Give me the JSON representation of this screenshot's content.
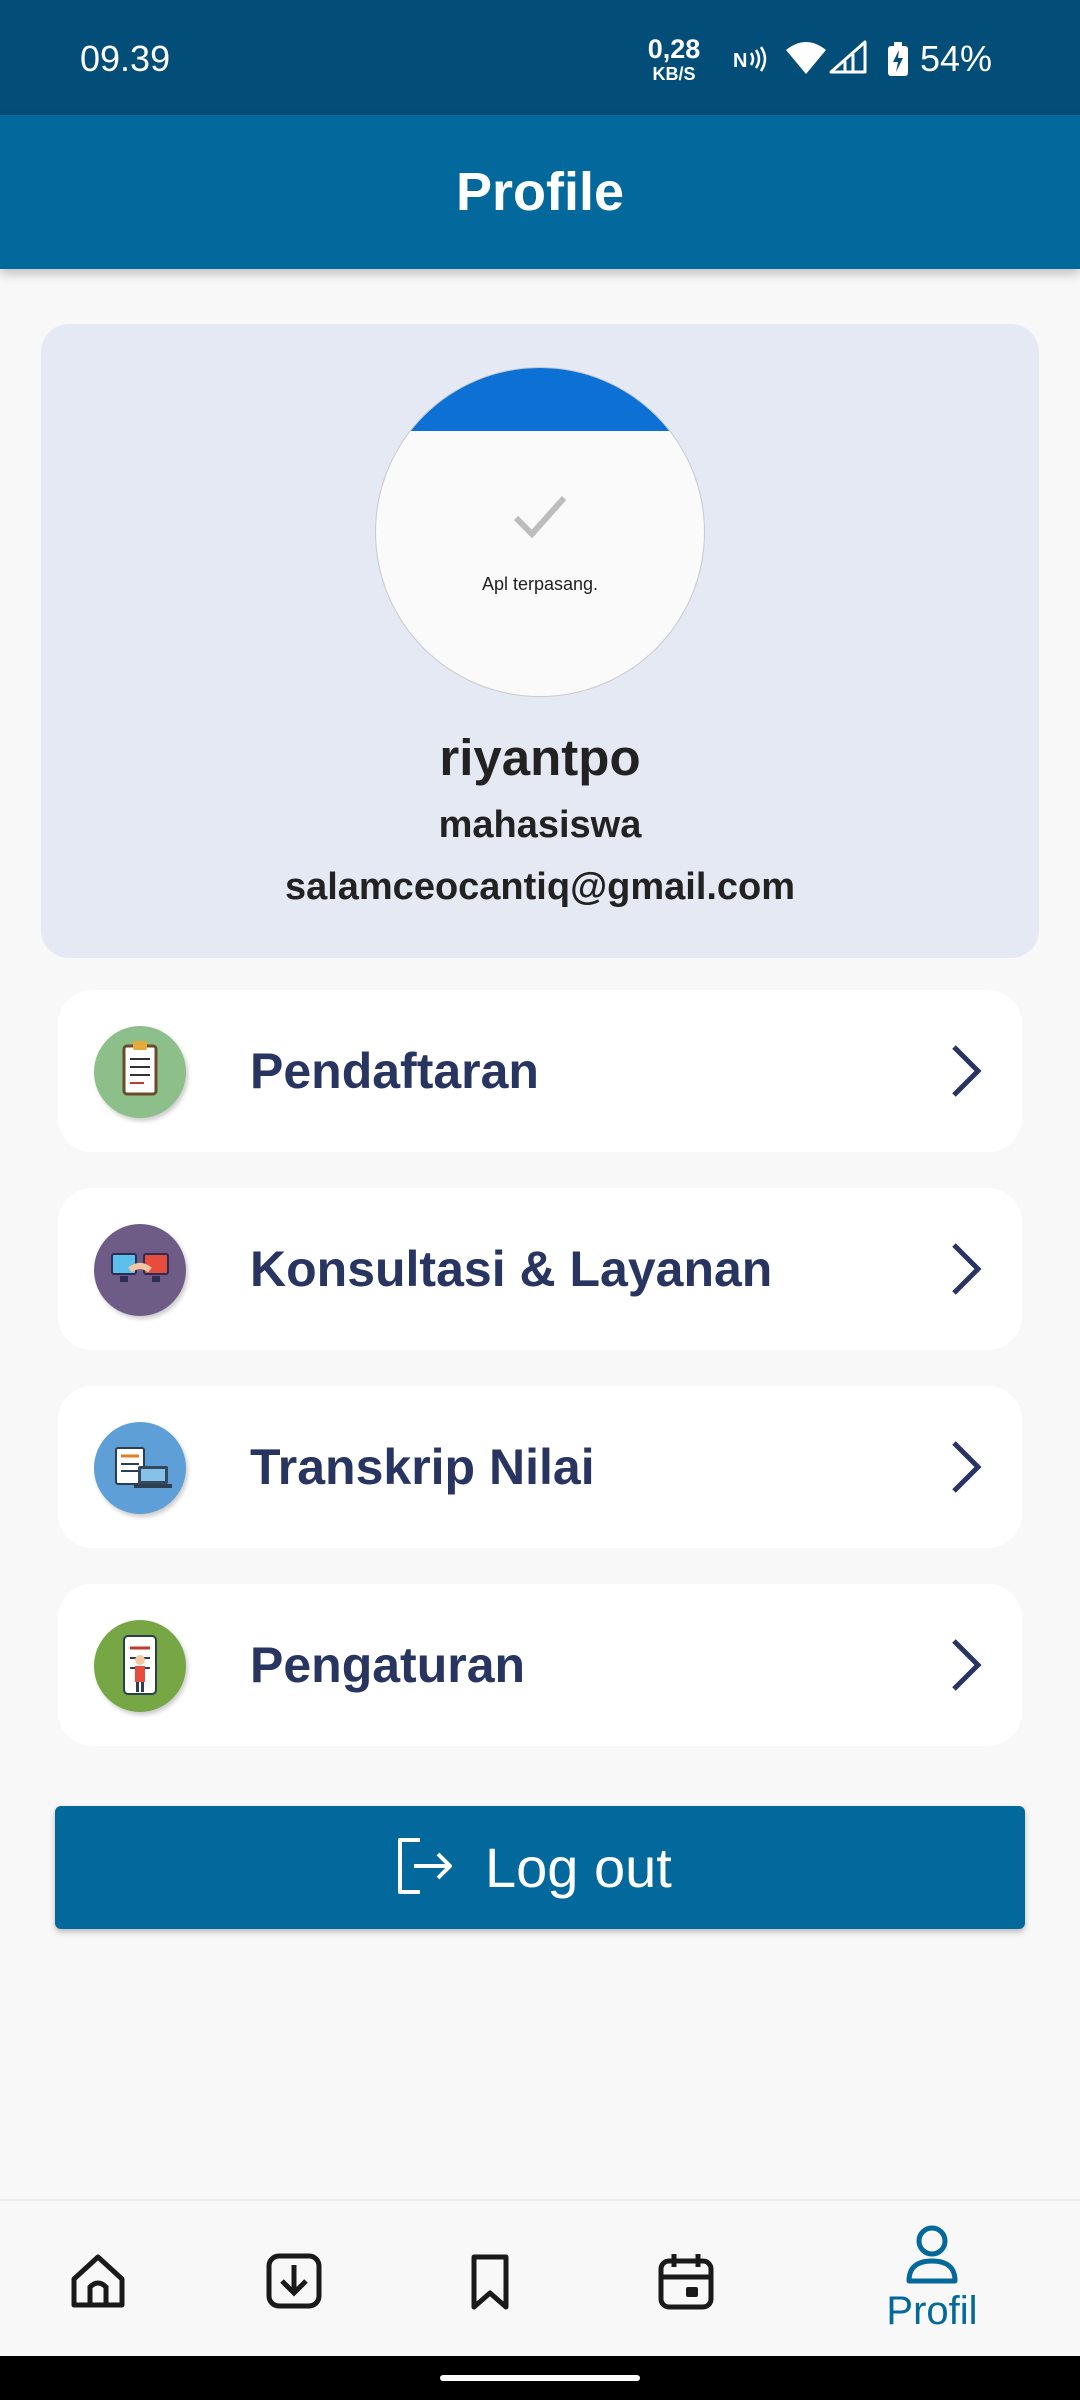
{
  "status_bar": {
    "time": "09.39",
    "net_speed_value": "0,28",
    "net_speed_unit": "KB/S",
    "battery_text": "54%",
    "icons": [
      "nfc-icon",
      "wifi-icon",
      "cellular-signal-icon",
      "battery-charging-icon"
    ]
  },
  "app_bar": {
    "title": "Profile"
  },
  "profile": {
    "avatar_caption": "Apl terpasang.",
    "name": "riyantpo",
    "role": "mahasiswa",
    "email": "salamceocantiq@gmail.com"
  },
  "menu": {
    "items": [
      {
        "label": "Pendaftaran",
        "icon": "clipboard-icon",
        "icon_color": "#8CBF8A"
      },
      {
        "label": "Konsultasi & Layanan",
        "icon": "consultation-icon",
        "icon_color": "#6E5C86"
      },
      {
        "label": "Transkrip Nilai",
        "icon": "transcript-icon",
        "icon_color": "#5D9FD6"
      },
      {
        "label": "Pengaturan",
        "icon": "settings-checklist-icon",
        "icon_color": "#77A645"
      }
    ]
  },
  "logout": {
    "label": "Log out",
    "icon": "logout-icon"
  },
  "bottom_nav": {
    "items": [
      {
        "icon": "home-icon"
      },
      {
        "icon": "download-icon"
      },
      {
        "icon": "bookmark-icon"
      },
      {
        "icon": "calendar-icon"
      },
      {
        "icon": "user-icon",
        "label": "Profil",
        "active": true
      }
    ]
  },
  "colors": {
    "status_bar": "#034E78",
    "primary": "#03689C",
    "card_background": "#E5E9F3",
    "menu_text": "#283561",
    "page_background": "#F8F8F8"
  }
}
